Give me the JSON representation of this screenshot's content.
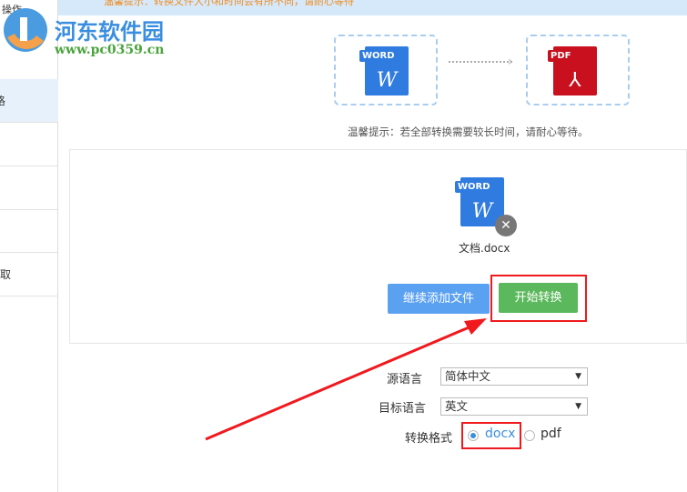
{
  "banner": {
    "text": "温馨提示：转换文件大小和时间会有所不同，请耐心等待"
  },
  "sidebar": {
    "header": "操作",
    "items": [
      {
        "label": "格"
      },
      {
        "label": ""
      },
      {
        "label": ""
      },
      {
        "label": ""
      },
      {
        "label": "取"
      }
    ]
  },
  "watermark": {
    "title": "河东软件园",
    "url": "www.pc0359.cn"
  },
  "flow": {
    "source_label": "WORD",
    "target_label": "PDF"
  },
  "hint": "温馨提示：若全部转换需要较长时间，请耐心等待。",
  "file": {
    "name": "文档.docx",
    "type_label": "WORD"
  },
  "buttons": {
    "add": "继续添加文件",
    "start": "开始转换"
  },
  "form": {
    "source_lang_label": "源语言",
    "source_lang": "简体中文",
    "target_lang_label": "目标语言",
    "target_lang": "英文",
    "format_label": "转换格式",
    "formats": [
      "docx",
      "pdf"
    ],
    "selected_format": "docx"
  },
  "colors": {
    "accent": "#5ba1f2",
    "start": "#5cb85c",
    "highlight": "#f0191e"
  }
}
